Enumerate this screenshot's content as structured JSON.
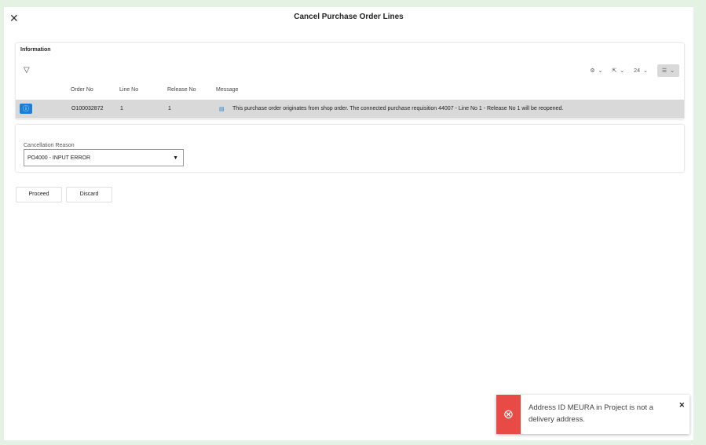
{
  "title": "Cancel Purchase Order Lines",
  "info": {
    "title": "Information",
    "page_size": "24",
    "columns": [
      "Order No",
      "Line No",
      "Release No",
      "Message"
    ],
    "rows": [
      {
        "order_no": "O100032872",
        "line_no": "1",
        "release_no": "1",
        "message": "This purchase order originates from shop order. The connected purchase requisition 44007 - Line No 1 - Release No 1 will be reopened."
      }
    ]
  },
  "reason": {
    "label": "Cancellation Reason",
    "value": "PO4000 - INPUT ERROR"
  },
  "buttons": {
    "proceed": "Proceed",
    "discard": "Discard"
  },
  "toast": {
    "message": "Address ID MEURA in Project is not a delivery address."
  }
}
